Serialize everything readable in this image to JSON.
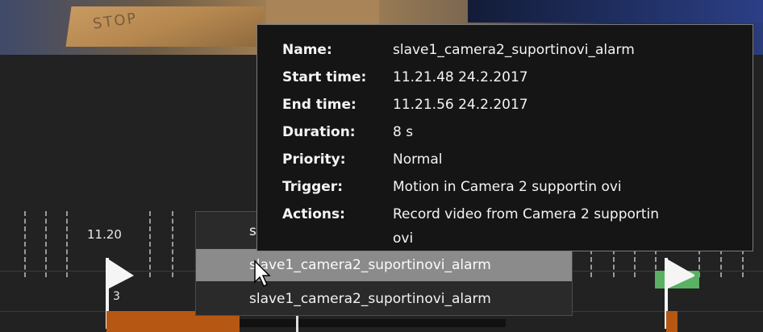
{
  "video": {
    "stamp_text": "STOP"
  },
  "timeline": {
    "time_label": "11.20",
    "event_count": "3"
  },
  "alarm_list": {
    "items": [
      "s",
      "slave1_camera2_suportinovi_alarm",
      "slave1_camera2_suportinovi_alarm"
    ],
    "highlighted_index": 1
  },
  "tooltip": {
    "name_label": "Name:",
    "name_value": "slave1_camera2_suportinovi_alarm",
    "start_label": "Start time:",
    "start_value": "11.21.48  24.2.2017",
    "end_label": "End time:",
    "end_value": "11.21.56  24.2.2017",
    "duration_label": "Duration:",
    "duration_value": "8 s",
    "priority_label": "Priority:",
    "priority_value": "Normal",
    "trigger_label": "Trigger:",
    "trigger_value": "Motion in Camera 2 supportin ovi",
    "actions_label": "Actions:",
    "actions_value_line1": "Record video from Camera 2 supportin",
    "actions_value_line2": "ovi"
  },
  "colors": {
    "orange_bar": "#b65713",
    "green_marker": "#5ab063",
    "highlight_row": "#8b8b8b",
    "tooltip_bg": "#151515"
  },
  "icons": {
    "flag": "flag-icon",
    "cursor": "mouse-pointer-icon"
  }
}
